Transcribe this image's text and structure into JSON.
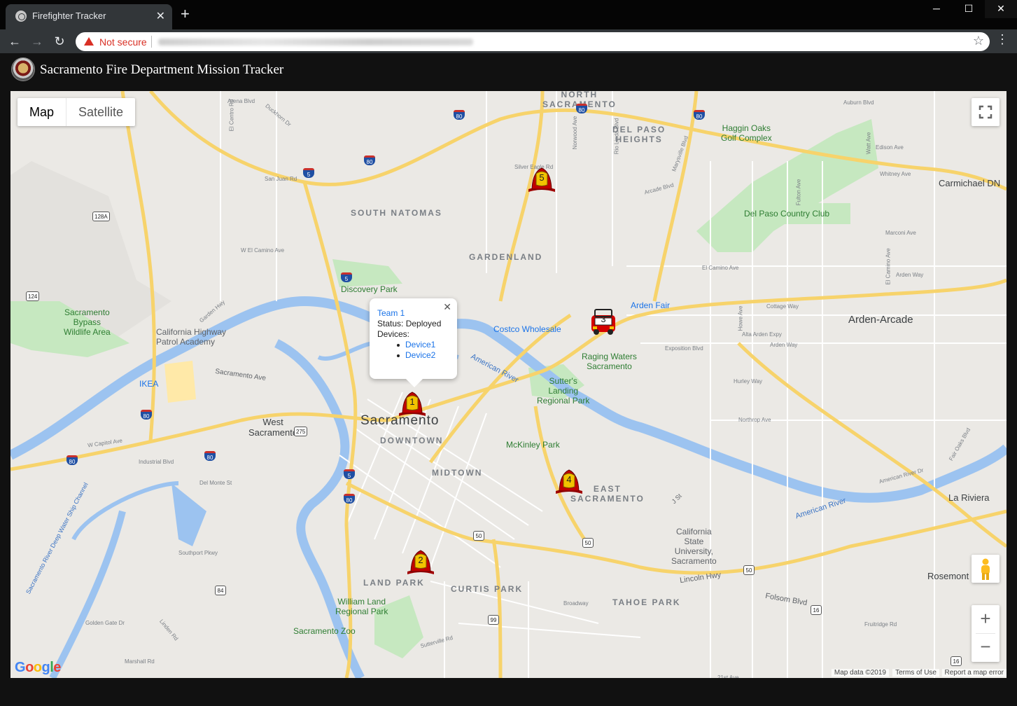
{
  "browser": {
    "tab_title": "Firefighter Tracker",
    "tab_close": "✕",
    "new_tab": "+",
    "security_text": "Not secure",
    "controls": {
      "minimize": "─",
      "maximize": "☐",
      "close": "✕"
    }
  },
  "app": {
    "title": "Sacramento Fire Department Mission Tracker"
  },
  "map": {
    "map_type": {
      "map": "Map",
      "satellite": "Satellite"
    },
    "zoom_in": "+",
    "zoom_out": "−",
    "labels": {
      "north_sacramento": "NORTH\nSACRAMENTO",
      "del_paso_heights": "DEL PASO\nHEIGHTS",
      "south_natomas": "SOUTH NATOMAS",
      "gardenland": "GARDENLAND",
      "sacramento": "Sacramento",
      "downtown": "DOWNTOWN",
      "midtown": "MIDTOWN",
      "east_sacramento": "EAST\nSACRAMENTO",
      "land_park": "LAND PARK",
      "curtis_park": "CURTIS PARK",
      "tahoe_park": "TAHOE PARK",
      "arden_arcade": "Arden-Arcade",
      "carmichael": "Carmichael DN",
      "la_riviera": "La Riviera",
      "rosemont": "Rosemont",
      "west_sacramento": "West\nSacramento",
      "haggin_oaks": "Haggin Oaks\nGolf Complex",
      "del_paso_country_club": "Del Paso Country Club",
      "discovery_park": "Discovery Park",
      "bypass": "Sacramento\nBypass\nWildlife Area",
      "chp_academy": "California Highway\nPatrol Academy",
      "ikea": "IKEA",
      "costco": "Costco Wholesale",
      "arden_fair": "Arden Fair",
      "raging_waters": "Raging Waters\nSacramento",
      "sutters_landing": "Sutter's\nLanding\nRegional Park",
      "mckinley_park": "McKinley Park",
      "william_land": "William Land\nRegional Park",
      "zoo": "Sacramento Zoo",
      "csus": "California\nState\nUniversity,\nSacramento",
      "american_river_1": "American River",
      "american_river_2": "American River",
      "sacramento_ave": "Sacramento Ave",
      "j_street": "J St",
      "folsom_blvd": "Folsom Blvd",
      "lincoln_hwy": "Lincoln Hwy",
      "ship_channel": "Sacramento River Deep Water Ship Channel"
    },
    "road_labels": [
      "El Camino Ave",
      "Marconi Ave",
      "Edison Ave",
      "Whitney Ave",
      "Arden Way",
      "Fair Oaks Blvd",
      "Auburn Blvd",
      "Watt Ave",
      "Howe Ave",
      "Fulton Ave",
      "El Camino Ave",
      "Arden Way",
      "Cottage Way",
      "Northrop Ave",
      "Hurley Way",
      "Exposition Blvd",
      "Alta Arden Expy",
      "American River Dr",
      "Broadway",
      "21st Ave",
      "Fruitridge Rd",
      "Sutterville Rd",
      "Marshall Rd",
      "Golden Gate Dr",
      "Linden Rd",
      "Southport Pkwy",
      "Industrial Blvd",
      "W Capitol Ave",
      "Del Monte St",
      "W El Camino Ave",
      "San Juan Rd",
      "Garden Hwy",
      "Arena Blvd",
      "Duckhorn Dr",
      "El Centro Rd",
      "Silver Eagle Rd",
      "Norwood Ave",
      "Rio Linda Blvd",
      "Marysville Blvd",
      "Arcade Blvd"
    ],
    "shields": [
      "80",
      "80",
      "80",
      "80",
      "80",
      "80",
      "80",
      "80",
      "5",
      "5",
      "5",
      "50",
      "50",
      "50",
      "99",
      "16",
      "16",
      "124",
      "128A",
      "275",
      "84"
    ],
    "info_window": {
      "team_name": "Team 1",
      "status": "Status: Deployed",
      "devices_label": "Devices:",
      "devices": [
        "Device1",
        "Device2"
      ],
      "close": "✕"
    },
    "markers": [
      {
        "team": "1",
        "type": "helmet"
      },
      {
        "team": "2",
        "type": "helmet"
      },
      {
        "team": "3",
        "type": "truck"
      },
      {
        "team": "4",
        "type": "helmet"
      },
      {
        "team": "5",
        "type": "helmet"
      }
    ],
    "footer": {
      "google": "Google",
      "map_data": "Map data ©2019",
      "terms": "Terms of Use",
      "report": "Report a map error"
    },
    "colors": {
      "land": "#ebe9e5",
      "water": "#9cc3f0",
      "park": "#c6e8c0",
      "freeway": "#f7d36b",
      "road": "#ffffff",
      "marker_red": "#a00000",
      "marker_yellow": "#f2c300"
    }
  }
}
